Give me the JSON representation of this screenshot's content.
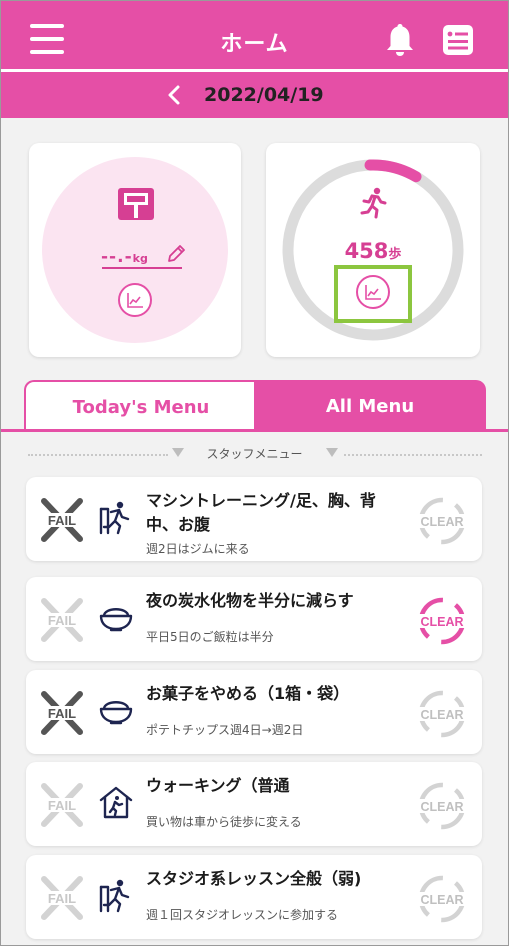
{
  "header": {
    "title": "ホーム",
    "date": "2022/04/19",
    "menu_icon": "hamburger-icon",
    "bell_icon": "bell-icon",
    "list_icon": "list-icon"
  },
  "weight": {
    "value": "--.-",
    "unit": "kg",
    "icon": "scale-icon"
  },
  "steps": {
    "value": "458",
    "unit": "歩",
    "progress": 0.09,
    "icon": "runner-icon"
  },
  "tabs": {
    "today": "Today's Menu",
    "all": "All Menu",
    "active": "all"
  },
  "section_label": "スタッフメニュー",
  "menu_items": [
    {
      "title": "マシントレーニング/足、胸、背中、お腹",
      "subtitle": "週2日はジムに来る",
      "icon": "training-icon",
      "fail": "FAIL",
      "clear": "CLEAR",
      "fail_active": true,
      "clear_active": false
    },
    {
      "title": "夜の炭水化物を半分に減らす",
      "subtitle": "平日5日のご飯粒は半分",
      "icon": "rice-bowl-icon",
      "fail": "FAIL",
      "clear": "CLEAR",
      "fail_active": false,
      "clear_active": true
    },
    {
      "title": "お菓子をやめる（1箱・袋）",
      "subtitle": "ポテトチップス週4日→週2日",
      "icon": "rice-bowl-icon",
      "fail": "FAIL",
      "clear": "CLEAR",
      "fail_active": true,
      "clear_active": false
    },
    {
      "title": "ウォーキング（普通",
      "subtitle": "買い物は車から徒歩に変える",
      "icon": "house-walk-icon",
      "fail": "FAIL",
      "clear": "CLEAR",
      "fail_active": false,
      "clear_active": false
    },
    {
      "title": "スタジオ系レッスン全般（弱)",
      "subtitle": "週１回スタジオレッスンに参加する",
      "icon": "training-icon",
      "fail": "FAIL",
      "clear": "CLEAR",
      "fail_active": false,
      "clear_active": false
    }
  ],
  "colors": {
    "brand": "#e54fa6",
    "weight_bg": "#fbe4f1",
    "ring_bg": "#dcdcdc",
    "inactive": "#cccccc",
    "fail_active": "#555555",
    "highlight": "#8cc63f"
  }
}
